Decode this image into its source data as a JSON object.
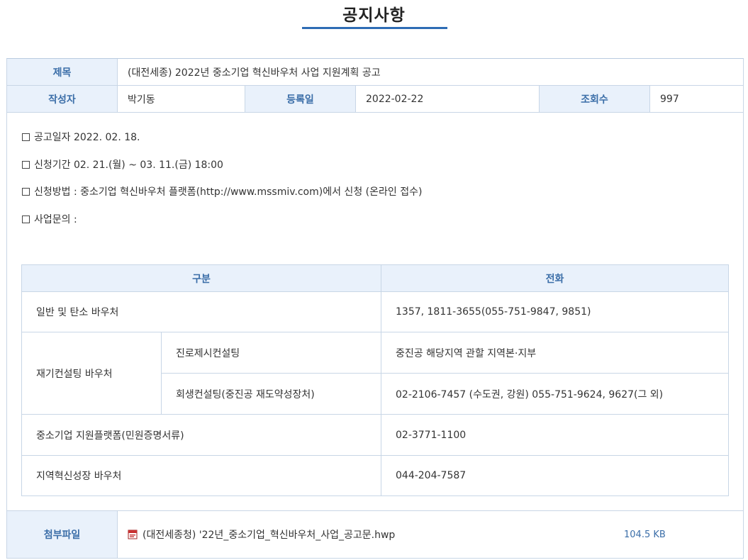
{
  "page": {
    "title": "공지사항"
  },
  "post": {
    "title_label": "제목",
    "title_value": "(대전세종) 2022년 중소기업 혁신바우처 사업 지원계획 공고",
    "author_label": "작성자",
    "author_value": "박기동",
    "date_label": "등록일",
    "date_value": "2022-02-22",
    "views_label": "조회수",
    "views_value": "997"
  },
  "body": {
    "lines": [
      "공고일자 2022. 02. 18.",
      "신청기간 02. 21.(월) ~ 03. 11.(금) 18:00",
      "신청방법 : 중소기업 혁신바우처 플랫폼(http://www.mssmiv.com)에서 신청 (온라인 접수)",
      "사업문의 :"
    ],
    "contact_table": {
      "headers": [
        "구분",
        "전화"
      ],
      "rows": [
        {
          "category": "일반 및 탄소 바우처",
          "phone": "1357, 1811-3655(055-751-9847, 9851)"
        },
        {
          "category": "재기컨설팅 바우처",
          "sub": [
            {
              "name": "진로제시컨설팅",
              "phone": "중진공 해당지역 관할 지역본·지부"
            },
            {
              "name": "회생컨설팅(중진공 재도약성장처)",
              "phone": "02-2106-7457 (수도권, 강원) 055-751-9624, 9627(그 외)"
            }
          ]
        },
        {
          "category": "중소기업 지원플랫폼(민원증명서류)",
          "phone": "02-3771-1100"
        },
        {
          "category": "지역혁신성장 바우처",
          "phone": "044-204-7587"
        }
      ]
    }
  },
  "attachment": {
    "label": "첨부파일",
    "file_icon": "hwp-file-icon",
    "file_name": "(대전세종청) '22년_중소기업_혁신바우처_사업_공고문.hwp",
    "file_size": "104.5 KB"
  },
  "colors": {
    "accent": "#2e6cb5",
    "header_bg": "#e9f1fb",
    "header_text": "#3b6ea8",
    "border": "#c8d6e6"
  }
}
